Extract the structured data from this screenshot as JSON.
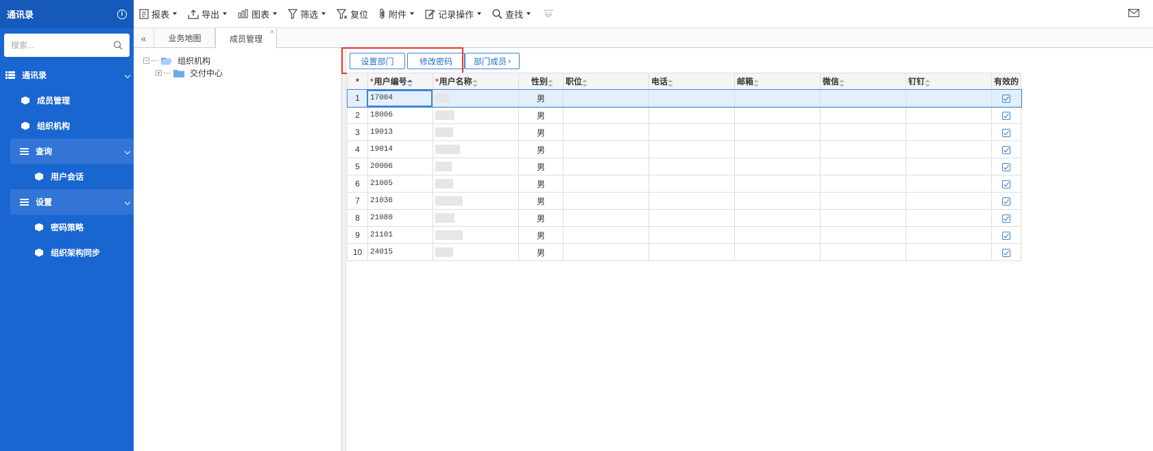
{
  "sidebar": {
    "title": "通讯录",
    "search_placeholder": "搜索...",
    "items": [
      {
        "label": "通讯录"
      },
      {
        "label": "成员管理"
      },
      {
        "label": "组织机构"
      },
      {
        "label": "查询"
      },
      {
        "label": "用户会话"
      },
      {
        "label": "设置"
      },
      {
        "label": "密码策略"
      },
      {
        "label": "组织架构同步"
      }
    ]
  },
  "toolbar": {
    "report": "报表",
    "export": "导出",
    "chart": "图表",
    "filter": "筛选",
    "reset": "复位",
    "attachment": "附件",
    "record_ops": "记录操作",
    "find": "查找"
  },
  "tabs": [
    {
      "label": "业务地图"
    },
    {
      "label": "成员管理"
    }
  ],
  "tree": {
    "root": "组织机构",
    "child": "交付中心"
  },
  "actions": {
    "set_dept": "设置部门",
    "change_pwd": "修改密码",
    "dept_members": "部门成员"
  },
  "grid": {
    "headers": {
      "rownum": "*",
      "user_code": "用户编号",
      "user_name": "用户名称",
      "gender": "性别",
      "position": "职位",
      "phone": "电话",
      "email": "邮箱",
      "wechat": "微信",
      "dingtalk": "钉钉",
      "valid": "有效的"
    },
    "rows": [
      {
        "n": "1",
        "code": "17004",
        "gender": "男"
      },
      {
        "n": "2",
        "code": "18006",
        "gender": "男"
      },
      {
        "n": "3",
        "code": "19013",
        "gender": "男"
      },
      {
        "n": "4",
        "code": "19014",
        "gender": "男"
      },
      {
        "n": "5",
        "code": "20006",
        "gender": "男"
      },
      {
        "n": "6",
        "code": "21005",
        "gender": "男"
      },
      {
        "n": "7",
        "code": "21036",
        "gender": "男"
      },
      {
        "n": "8",
        "code": "21080",
        "gender": "男"
      },
      {
        "n": "9",
        "code": "21101",
        "gender": "男"
      },
      {
        "n": "10",
        "code": "24015",
        "gender": "男"
      }
    ]
  },
  "colors": {
    "sidebar_bg": "#1a66d1",
    "accent": "#3a83d6",
    "highlight_box": "#e53333"
  }
}
